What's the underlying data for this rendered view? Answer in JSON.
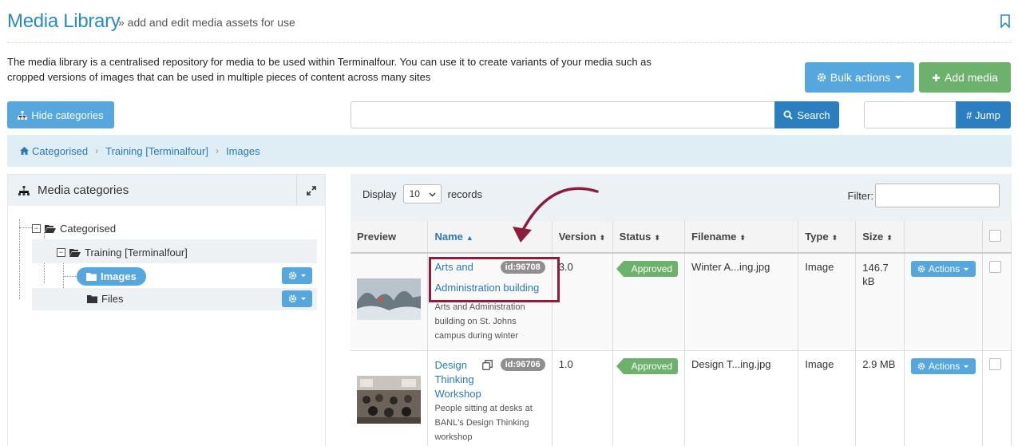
{
  "header": {
    "title": "Media Library",
    "subtitle": "» add and edit media assets for use"
  },
  "intro": "The media library is a centralised repository for media to be used within Terminalfour. You can use it to create variants of your media such as cropped versions of images that can be used in multiple pieces of content across many sites",
  "toolbar": {
    "bulk_actions": "Bulk actions",
    "add_media": "Add media",
    "hide_categories": "Hide categories",
    "search_placeholder": "",
    "search_label": "Search",
    "jump_label": "# Jump"
  },
  "breadcrumb": [
    "Categorised",
    "Training [Terminalfour]",
    "Images"
  ],
  "categories": {
    "title": "Media categories",
    "tree": [
      {
        "label": "Categorised"
      },
      {
        "label": "Training [Terminalfour]"
      },
      {
        "label": "Images",
        "selected": true
      },
      {
        "label": "Files"
      }
    ]
  },
  "list": {
    "display_label": "Display",
    "records_label": "records",
    "page_size": "10",
    "filter_label": "Filter:",
    "columns": [
      "Preview",
      "Name",
      "Version",
      "Status",
      "Filename",
      "Type",
      "Size"
    ],
    "rows": [
      {
        "name_line1": "Arts and",
        "name_line2": "Administration building",
        "id": "id:96708",
        "desc_lines": [
          "Arts and Administration",
          "building on St. Johns",
          "campus during winter"
        ],
        "version": "3.0",
        "status": "Approved",
        "filename": "Winter A...ing.jpg",
        "type": "Image",
        "size_line1": "146.7",
        "size_line2": "kB",
        "actions": "Actions"
      },
      {
        "name_lines": [
          "Design",
          "Thinking",
          "Workshop"
        ],
        "id": "id:96706",
        "desc_lines": [
          "People sitting at desks at",
          "BANL's Design Thinking",
          "workshop"
        ],
        "version": "1.0",
        "status": "Approved",
        "filename": "Design T...ing.jpg",
        "type": "Image",
        "size": "2.9 MB",
        "actions": "Actions"
      }
    ]
  },
  "colors": {
    "primary": "#55a7dd",
    "dark_primary": "#2b7fc0",
    "success": "#6cb26c",
    "highlight": "#8b1e3a"
  }
}
